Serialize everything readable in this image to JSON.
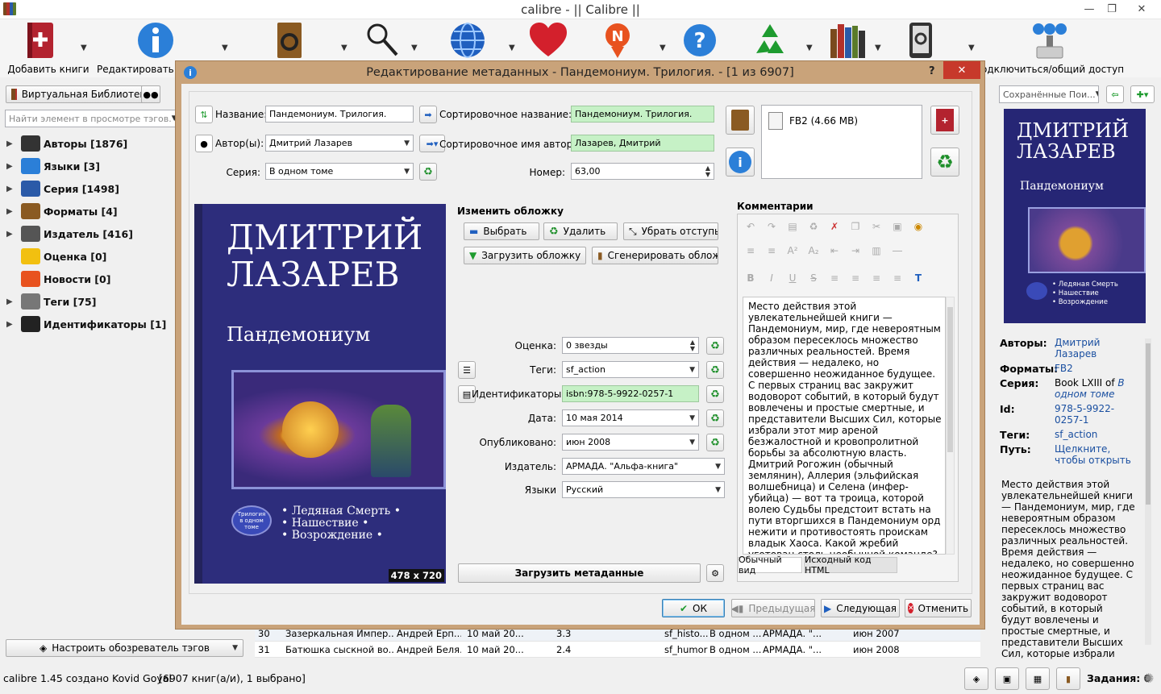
{
  "window": {
    "title": "calibre - || Calibre ||"
  },
  "toolbar": {
    "add_books": "Добавить книги",
    "edit_metadata": "Редактировать метаданные",
    "connect_share": "Подключиться/общий доступ"
  },
  "left": {
    "virtual_library": "Виртуальная Библиотека",
    "search_placeholder": "Найти элемент в просмотре тэгов.",
    "tree": [
      {
        "label": "Авторы [1876]",
        "icon": "person-icon",
        "expand": true
      },
      {
        "label": "Языки [3]",
        "icon": "languages-icon",
        "expand": true
      },
      {
        "label": "Серия [1498]",
        "icon": "series-icon",
        "expand": true
      },
      {
        "label": "Форматы [4]",
        "icon": "book-icon",
        "expand": true
      },
      {
        "label": "Издатель [416]",
        "icon": "publisher-icon",
        "expand": true
      },
      {
        "label": "Оценка [0]",
        "icon": "star-icon",
        "expand": false
      },
      {
        "label": "Новости [0]",
        "icon": "news-icon",
        "expand": false
      },
      {
        "label": "Теги [75]",
        "icon": "tag-icon",
        "expand": true
      },
      {
        "label": "Идентификаторы [1]",
        "icon": "barcode-icon",
        "expand": true
      }
    ],
    "configure_tags": "Настроить обозреватель тэгов"
  },
  "search_bar": {
    "saved_searches": "Сохранённые Пои..."
  },
  "dialog": {
    "title": "Редактирование метаданных - Пандемониум. Трилогия. -   [1 из 6907]",
    "help": "?",
    "fields": {
      "title_label": "Название:",
      "title_value": "Пандемониум. Трилогия.",
      "sort_title_label": "Сортировочное название:",
      "sort_title_value": "Пандемониум. Трилогия.",
      "author_label": "Автор(ы):",
      "author_value": "Дмитрий Лазарев",
      "sort_author_label": "Сортировочное имя автора:",
      "sort_author_value": "Лазарев, Дмитрий",
      "series_label": "Серия:",
      "series_value": "В одном томе",
      "number_label": "Номер:",
      "number_value": "63,00"
    },
    "format_entry": "FB2 (4.66 MB)",
    "cover": {
      "author_line1": "ДМИТРИЙ",
      "author_line2": "ЛАЗАРЕВ",
      "title": "Пандемониум",
      "books": [
        "Ледяная Смерть",
        "Нашествие",
        "Возрождение"
      ],
      "badge": "Трилогия в одном томе",
      "size": "478 x 720"
    },
    "change_cover": {
      "heading": "Изменить обложку",
      "browse": "Выбрать",
      "remove": "Удалить",
      "trim": "Убрать отступы",
      "download": "Загрузить обложку",
      "generate": "Сгенерировать обложку"
    },
    "meta": {
      "rating_label": "Оценка:",
      "rating_value": "0 звезды",
      "tags_label": "Теги:",
      "tags_value": "sf_action",
      "ids_label": "Идентификаторы:",
      "ids_value": "isbn:978-5-9922-0257-1",
      "date_label": "Дата:",
      "date_value": "10 мая 2014",
      "published_label": "Опубликовано:",
      "published_value": "июн 2008",
      "publisher_label": "Издатель:",
      "publisher_value": "АРМАДА. \"Альфа-книга\"",
      "languages_label": "Языки",
      "languages_value": "Русский"
    },
    "download_metadata": "Загрузить метаданные",
    "comments": {
      "heading": "Комментарии",
      "text": "Место действия этой увлекательнейшей книги — Пандемониум, мир, где невероятным образом пересеклось множество различных реальностей. Время действия — недалеко, но совершенно неожиданное будущее. С первых страниц вас закружит водоворот событий, в который будут вовлечены и простые смертные, и представители Высших Сил, которые избрали этот мир ареной безжалостной и кровопролитной борьбы за абсолютную власть. Дмитрий Рогожин (обычный землянин), Аллерия (эльфийская волшебница) и Селена (инфер-убийца) — вот та троица, которой волею Судьбы предстоит встать на пути вторгшихся в Пандемониум орд нежити и противостоять проискам владык Хаоса. Какой жребий уготован столь необычной команде? Участь безвестно павших или спасителей всего",
      "tab_normal": "Обычный вид",
      "tab_html": "Исходный код HTML"
    },
    "buttons": {
      "ok": "ОК",
      "prev": "Предыдущая",
      "next": "Следующая",
      "cancel": "Отменить"
    }
  },
  "table_rows": [
    {
      "num": "30",
      "title": "Зазеркальная Импер...",
      "author": "Андрей Ерп...",
      "date": "10 май 20...",
      "rating": "3.3",
      "tags": "sf_histo...",
      "series": "В одном ...",
      "publisher": "АРМАДА. \"...",
      "published": "июн 2007"
    },
    {
      "num": "31",
      "title": "Батюшка сыскной во...",
      "author": "Андрей Беля...",
      "date": "10 май 20...",
      "rating": "2.4",
      "tags": "sf_humor",
      "series": "В одном ...",
      "publisher": "АРМАДА. \"...",
      "published": "июн 2008"
    }
  ],
  "right": {
    "cover_author": "ДМИТРИЙ ЛАЗАРЕВ",
    "cover_title": "Пандемониум",
    "cover_books": [
      "Ледяная Смерть",
      "Нашествие",
      "Возрождение"
    ],
    "authors_label": "Авторы:",
    "authors_value": "Дмитрий Лазарев",
    "formats_label": "Форматы:",
    "formats_value": "FB2",
    "series_label": "Серия:",
    "series_prefix": "Book LXIII of",
    "series_value": "В одном томе",
    "id_label": "Id:",
    "id_value": "978-5-9922-0257-1",
    "tags_label": "Теги:",
    "tags_value": "sf_action",
    "path_label": "Путь:",
    "path_value": "Щелкните, чтобы открыть",
    "comment": "Место действия этой увлекательнейшей книги — Пандемониум, мир, где невероятным образом пересеклось множество различных реальностей. Время действия — недалеко, но совершенно неожиданное будущее. С первых страниц вас закружит водоворот событий, в который будут вовлечены и простые смертные, и представители Высших Сил, которые избрали этот мир ареной"
  },
  "status": {
    "left": "calibre 1.45 создано Kovid Goyal",
    "count": "[6907 книг(а/и), 1 выбрано]",
    "jobs": "Задания: 0"
  },
  "colors": {
    "accent": "#2b7fd8",
    "dialog_frame": "#c9a37a",
    "green_field": "#c6f1c6",
    "cover_bg": "#2a2a7a"
  }
}
